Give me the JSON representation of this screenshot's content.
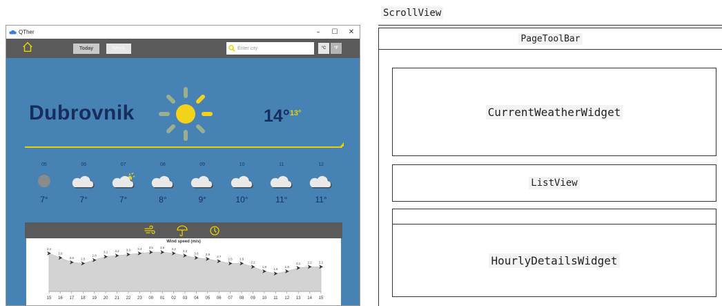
{
  "window": {
    "title": "QTher",
    "controls": {
      "minimize": "–",
      "maximize": "☐",
      "close": "✕"
    }
  },
  "toolbar": {
    "today_label": "Today",
    "week_label": "Week",
    "search_placeholder": "Enter city",
    "unit_c": "°C",
    "unit_f": "°F"
  },
  "current": {
    "city": "Dubrovnik",
    "temp": "14°",
    "feels": "13°",
    "icon": "sun-icon"
  },
  "hourly": [
    {
      "hour": "05",
      "temp": "7°",
      "icon": "fog-icon"
    },
    {
      "hour": "06",
      "temp": "7°",
      "icon": "cloud-icon"
    },
    {
      "hour": "07",
      "temp": "7°",
      "icon": "cloud-sun-icon"
    },
    {
      "hour": "08",
      "temp": "8°",
      "icon": "cloud-icon"
    },
    {
      "hour": "09",
      "temp": "9°",
      "icon": "cloud-icon"
    },
    {
      "hour": "10",
      "temp": "10°",
      "icon": "cloud-icon"
    },
    {
      "hour": "11",
      "temp": "11°",
      "icon": "cloud-icon"
    },
    {
      "hour": "12",
      "temp": "11°",
      "icon": "cloud-icon"
    }
  ],
  "details_tabs": [
    "wind-icon",
    "umbrella-icon",
    "pressure-icon"
  ],
  "chart_data": {
    "type": "area",
    "title": "Wind speed (m/s)",
    "x": [
      "15",
      "16",
      "17",
      "18",
      "19",
      "20",
      "21",
      "22",
      "23",
      "00",
      "01",
      "02",
      "03",
      "04",
      "05",
      "06",
      "07",
      "08",
      "09",
      "10",
      "11",
      "12",
      "13",
      "14",
      "15"
    ],
    "values": [
      3.4,
      3.0,
      2.6,
      2.5,
      2.8,
      3.1,
      3.2,
      3.3,
      3.4,
      3.5,
      3.5,
      3.4,
      3.2,
      3.0,
      2.9,
      2.7,
      2.5,
      2.5,
      2.2,
      1.8,
      1.6,
      1.8,
      2.1,
      2.2,
      2.2
    ],
    "ylim": [
      0,
      4
    ],
    "grid": false,
    "colors": {
      "fill": "#d3d3d3",
      "line": "#bbbbbb"
    }
  },
  "diagram": {
    "scrollview": "ScrollView",
    "pagetoolbar": "PageToolBar",
    "current_weather": "CurrentWeatherWidget",
    "listview": "ListView",
    "hourly_details": "HourlyDetailsWidget"
  },
  "colors": {
    "accent": "#e6d200",
    "background": "#4682b4",
    "toolbar": "#5a5a5a",
    "text_dark": "#162d5e"
  }
}
